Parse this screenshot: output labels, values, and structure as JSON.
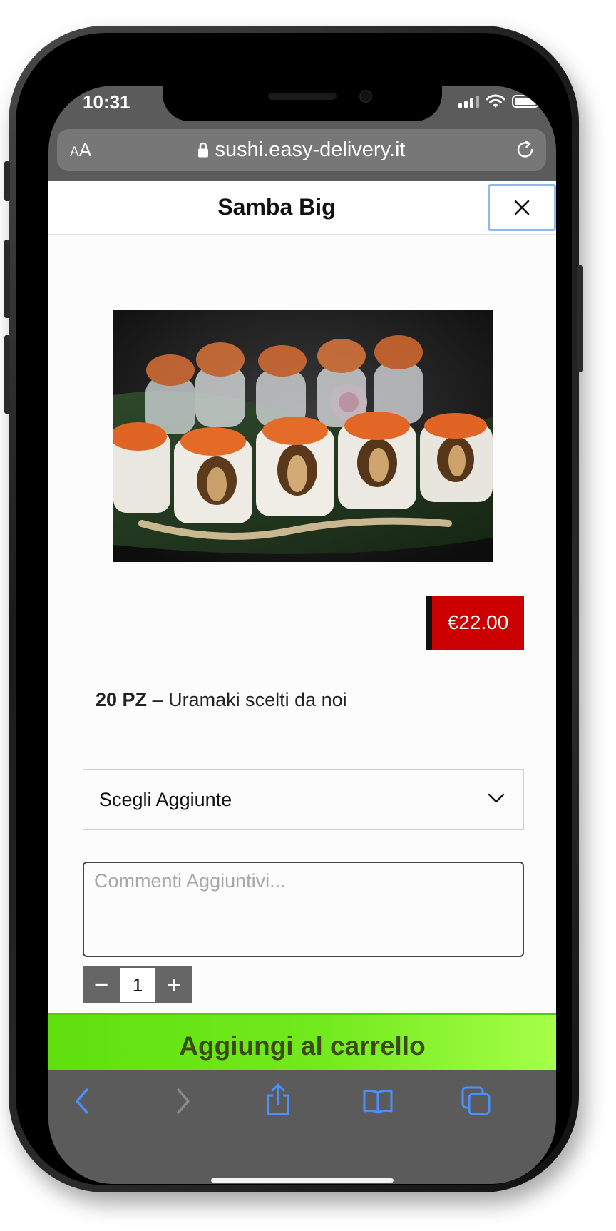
{
  "status_bar": {
    "time": "10:31"
  },
  "browser": {
    "text_size_small": "A",
    "text_size_large": "A",
    "url": "sushi.easy-delivery.it"
  },
  "modal": {
    "title": "Samba Big",
    "price": "€22.00",
    "description_bold": "20 PZ",
    "description_text": " – Uramaki scelti da noi",
    "addons_select_label": "Scegli Aggiunte",
    "comments_placeholder": "Commenti Aggiuntivi...",
    "quantity": "1",
    "minus_label": "−",
    "plus_label": "+",
    "add_to_cart_label": "Aggiungi al carrello"
  },
  "colors": {
    "price_badge": "#cc0000",
    "cart_button": "#73ea1e",
    "cart_text": "#3f4a10",
    "toolbar_icon": "#4a90ff",
    "toolbar_icon_disabled": "#8a8a8a"
  },
  "icons": [
    "lock-icon",
    "reload-icon",
    "close-icon",
    "chevron-down-icon",
    "back-icon",
    "forward-icon",
    "share-icon",
    "bookmarks-icon",
    "tabs-icon"
  ]
}
